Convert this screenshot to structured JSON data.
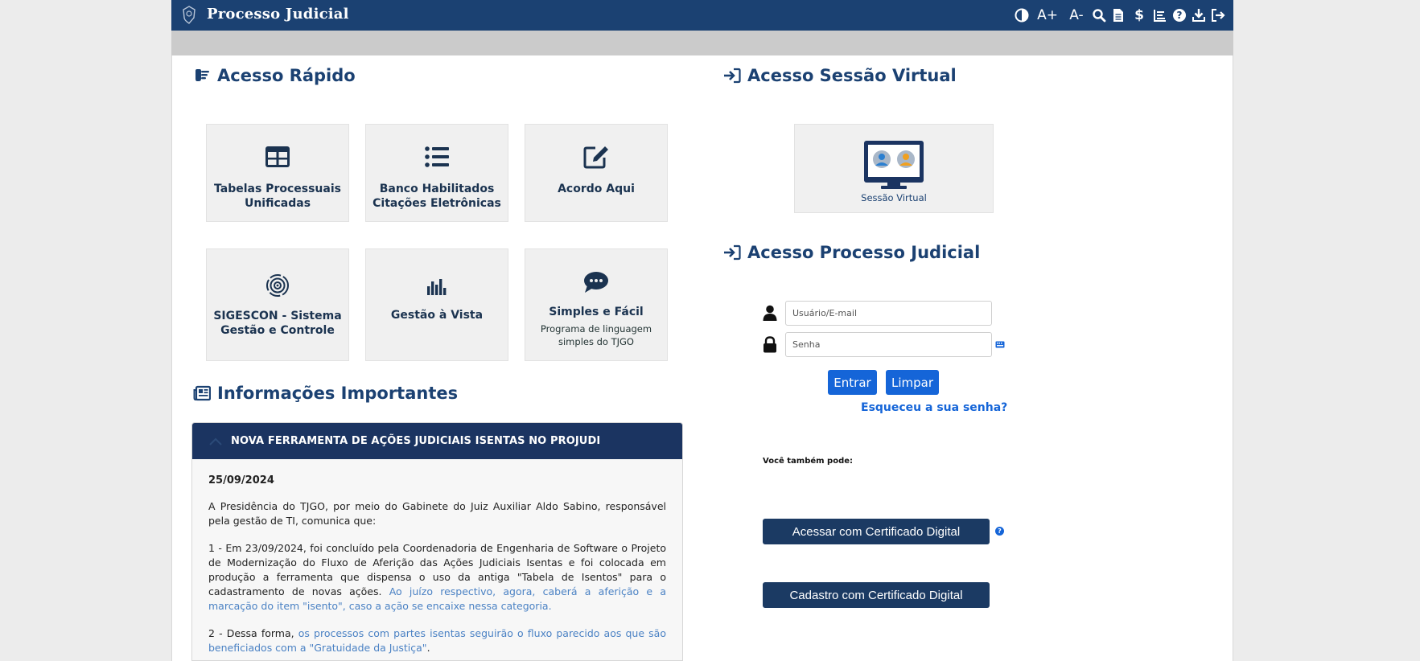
{
  "header": {
    "title": "Processo Judicial",
    "tools": {
      "contrast_icon": "contrast-icon",
      "font_increase": "A+",
      "font_decrease": "A-",
      "search_icon": "search-icon",
      "document_icon": "document-icon",
      "dollar": "$",
      "chart_icon": "bar-chart-icon",
      "help_icon": "help-icon",
      "download_icon": "download-icon",
      "logout_icon": "logout-icon"
    }
  },
  "quick_access": {
    "title": "Acesso Rápido",
    "tiles": [
      {
        "label": "Tabelas Processuais Unificadas",
        "icon": "table-icon"
      },
      {
        "label": "Banco Habilitados Citações Eletrônicas",
        "icon": "list-icon"
      },
      {
        "label": "Acordo Aqui",
        "icon": "edit-icon"
      },
      {
        "label": "SIGESCON - Sistema Gestão e Controle",
        "icon": "target-icon"
      },
      {
        "label": "Gestão à Vista",
        "icon": "bar-chart-icon"
      },
      {
        "label": "Simples e Fácil",
        "sub": "Programa de linguagem simples do TJGO",
        "icon": "chat-icon"
      }
    ]
  },
  "virtual_session": {
    "title": "Acesso Sessão Virtual",
    "tile_label": "Sessão Virtual"
  },
  "login": {
    "title": "Acesso Processo Judicial",
    "user_placeholder": "Usuário/E-mail",
    "password_placeholder": "Senha",
    "enter_label": "Entrar",
    "clear_label": "Limpar",
    "forgot_label": "Esqueceu a sua senha?",
    "also_label": "Você também pode:",
    "cert_access_label": "Acessar com Certificado Digital",
    "cert_register_label": "Cadastro com Certificado Digital"
  },
  "info": {
    "title": "Informações Importantes",
    "news_title": "NOVA FERRAMENTA DE AÇÕES JUDICIAIS ISENTAS NO PROJUDI",
    "date": "25/09/2024",
    "p1": "A Presidência do TJGO, por meio do Gabinete do Juiz Auxiliar Aldo Sabino, responsável pela gestão de TI, comunica que:",
    "p2_plain": "1 - Em 23/09/2024, foi concluído pela Coordenadoria de Engenharia de Software o Projeto de Modernização do Fluxo de Aferição das Ações Judiciais Isentas e foi colocada em produção a ferramenta que dispensa o uso da antiga \"Tabela de Isentos\" para o cadastramento de novas ações.",
    "p2_highlight": "Ao juízo respectivo, agora, caberá a aferição e a marcação do item \"isento\", caso a ação se encaixe nessa categoria.",
    "p3_plain": "2 - Dessa forma,",
    "p3_highlight": "os processos com partes isentas seguirão o fluxo parecido aos que são beneficiados com a \"Gratuidade da Justiça\"",
    "p3_end": "."
  },
  "colors": {
    "header_bg": "#1b4172",
    "accent_blue": "#1565d8",
    "dark_button": "#1b3a63",
    "news_header": "#1b3461"
  }
}
